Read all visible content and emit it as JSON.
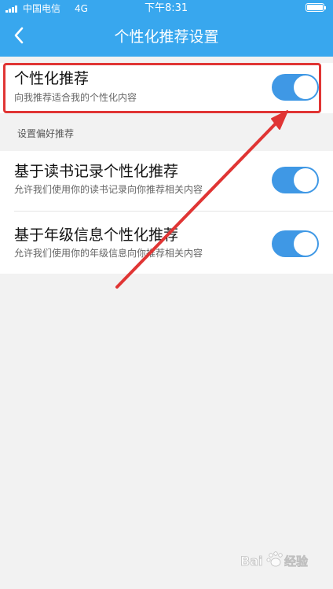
{
  "status_bar": {
    "carrier": "中国电信",
    "network": "4G",
    "time": "下午8:31"
  },
  "header": {
    "title": "个性化推荐设置"
  },
  "primary": {
    "title": "个性化推荐",
    "subtitle": "向我推荐适合我的个性化内容",
    "enabled": true
  },
  "section_label": "设置偏好推荐",
  "preferences": [
    {
      "title": "基于读书记录个性化推荐",
      "subtitle": "允许我们使用你的读书记录向你推荐相关内容",
      "enabled": true
    },
    {
      "title": "基于年级信息个性化推荐",
      "subtitle": "允许我们使用你的年级信息向你推荐相关内容",
      "enabled": true
    }
  ],
  "watermark": {
    "text": "Bai 经验"
  },
  "colors": {
    "header": "#38a7ee",
    "toggle_on": "#3f98e5",
    "annotation": "#e03534",
    "background": "#f2f2f2"
  }
}
